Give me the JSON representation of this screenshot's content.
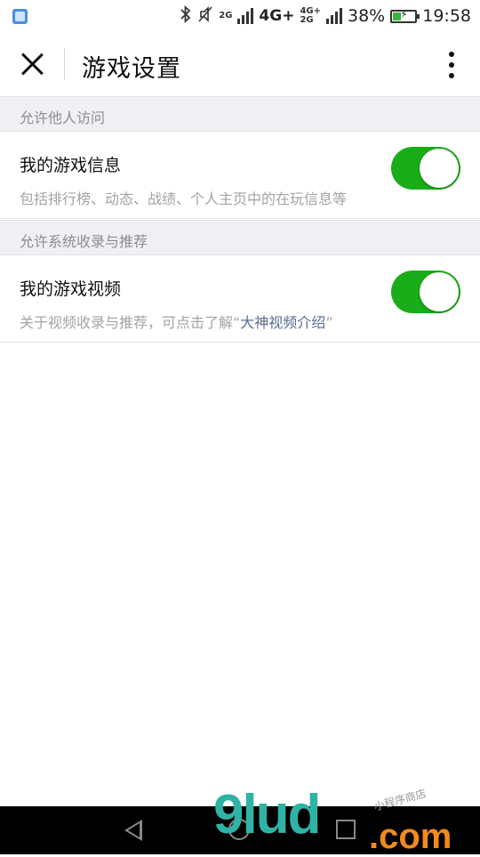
{
  "status_bar": {
    "net_2g": "2G",
    "net_4g": "4G+",
    "net_4g_small": "4G+",
    "net_2g_small": "2G",
    "battery_percent": "38%",
    "time": "19:58",
    "battery_level": 0.38,
    "icons": [
      "gallery-icon",
      "bluetooth-icon",
      "mute-icon",
      "signal-icon",
      "battery-charging-icon"
    ]
  },
  "nav": {
    "title": "游戏设置",
    "close_icon": "close-icon",
    "more_icon": "more-vertical-icon"
  },
  "sections": [
    {
      "header": "允许他人访问",
      "cell": {
        "title": "我的游戏信息",
        "description": "包括排行榜、动态、战绩、个人主页中的在玩信息等",
        "toggle_on": true
      }
    },
    {
      "header": "允许系统收录与推荐",
      "cell": {
        "title": "我的游戏视频",
        "description_prefix": "关于视频收录与推荐，可点击了解“",
        "description_link": "大神视频介绍",
        "description_suffix": "”",
        "toggle_on": true
      }
    }
  ],
  "colors": {
    "toggle_on": "#1aad19",
    "link": "#586c94",
    "section_bg": "#efeff4"
  },
  "watermark": {
    "main": "9lud",
    "suffix": ".com",
    "small": "小程序商店"
  },
  "system_nav": {
    "icons": [
      "back-icon",
      "home-icon",
      "recent-apps-icon"
    ]
  }
}
